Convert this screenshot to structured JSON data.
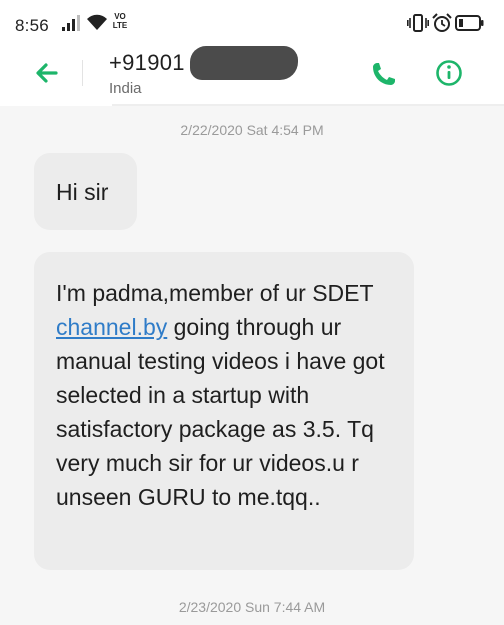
{
  "status_bar": {
    "time": "8:56",
    "network_label_top": "VO",
    "network_label_bottom": "LTE",
    "icons": [
      "signal-icon",
      "wifi-icon",
      "vibrate-icon",
      "alarm-icon",
      "battery-icon"
    ]
  },
  "header": {
    "contact_number": "+91901",
    "contact_country": "India",
    "icons": [
      "back-arrow-icon",
      "phone-icon",
      "info-icon"
    ],
    "accent_color": "#1db56a"
  },
  "conversation": {
    "messages": [
      {
        "timestamp": "2/22/2020 Sat 4:54 PM",
        "text": "Hi sir"
      },
      {
        "text_before_link": "I'm padma,member of ur SDET ",
        "link_text": "channel.by",
        "text_after_link": " going through ur manual testing videos i have got selected in a startup with satisfactory package as 3.5. Tq very much sir for ur videos.u r unseen GURU to me.tqq.."
      }
    ],
    "next_timestamp": "2/23/2020 Sun 7:44 AM",
    "bubble_color": "#ececec",
    "background_color": "#f6f6f6",
    "link_color": "#2f7cc8"
  }
}
